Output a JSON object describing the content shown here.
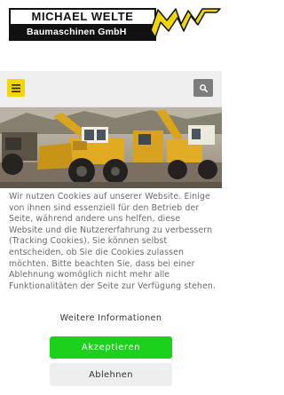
{
  "header": {
    "logo": {
      "company_name": "MICHAEL WELTE",
      "subtitle": "Baumaschinen GmbH",
      "brand_mark": "MW"
    }
  },
  "navbar": {
    "menu_icon": "hamburger-menu-icon",
    "search_icon": "search-icon"
  },
  "hero": {
    "description": "construction machinery yard photo"
  },
  "cookie_banner": {
    "text": "Wir nutzen Cookies auf unserer Website. Einige von ihnen sind essenziell für den Betrieb der Seite, während andere uns helfen, diese Website und die Nutzererfahrung zu verbessern (Tracking Cookies). Sie können selbst entscheiden, ob Sie die Cookies zulassen möchten. Bitte beachten Sie, dass bei einer Ablehnung womöglich nicht mehr alle Funktionalitäten der Seite zur Verfügung stehen.",
    "more_info_label": "Weitere Informationen",
    "accept_label": "Akzeptieren",
    "decline_label": "Ablehnen"
  },
  "colors": {
    "brand_yellow": "#f2d600",
    "accept_green": "#1bd11b",
    "search_gray": "#7d7d7d",
    "navbar_bg": "#efefef",
    "decline_bg": "#eeeeee",
    "body_text": "#6a6a6a"
  }
}
